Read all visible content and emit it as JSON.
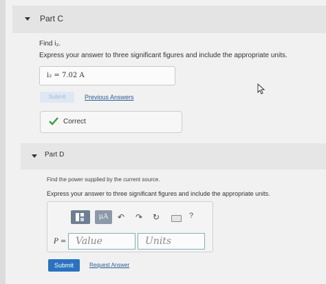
{
  "part_c": {
    "title": "Part C",
    "find": "Find i₂.",
    "instructions": "Express your answer to three significant figures and include the appropriate units.",
    "answer": "i₂ =  7.02 A",
    "submit_label": "Submit",
    "previous_answers_label": "Previous Answers",
    "feedback": "Correct"
  },
  "part_d": {
    "title": "Part D",
    "find": "Find the power supplied by the current source.",
    "instructions": "Express your answer to three significant figures and include the appropriate units.",
    "toolbar": {
      "units_label": "μA",
      "undo_icon": "↶",
      "redo_icon": "↷",
      "reset_icon": "↻",
      "help_label": "?"
    },
    "variable_label": "P =",
    "value_placeholder": "Value",
    "units_placeholder": "Units",
    "submit_label": "Submit",
    "request_answer_label": "Request Answer"
  },
  "colors": {
    "submit_blue": "#2a72bf",
    "link_blue": "#2a5b94",
    "correct_green": "#3c9a3c",
    "field_border": "#7fb0b4"
  }
}
